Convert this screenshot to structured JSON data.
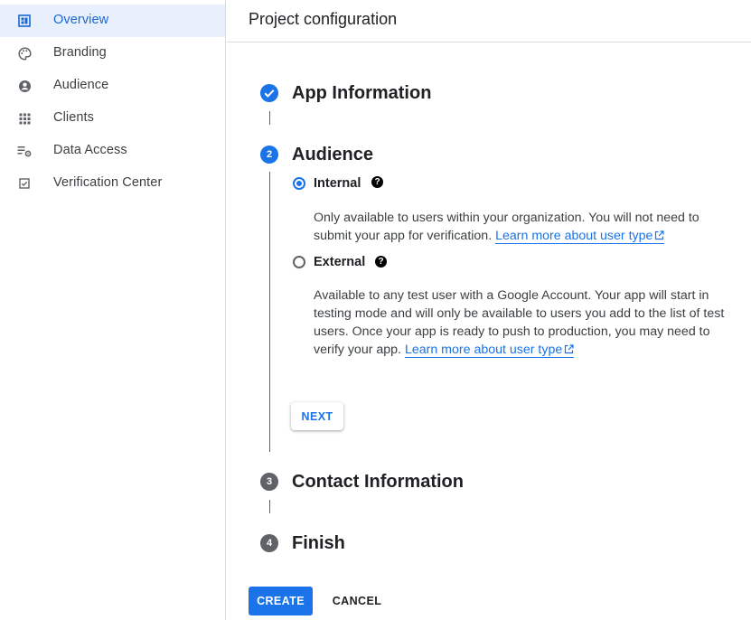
{
  "colors": {
    "accent": "#1a73e8",
    "active_bg": "#e8f0fe",
    "inactive_step": "#5f6368",
    "divider": "#dadce0"
  },
  "sidebar": {
    "items": [
      {
        "label": "Overview",
        "icon": "dashboard-icon",
        "active": true
      },
      {
        "label": "Branding",
        "icon": "palette-icon",
        "active": false
      },
      {
        "label": "Audience",
        "icon": "account-circle-icon",
        "active": false
      },
      {
        "label": "Clients",
        "icon": "apps-grid-icon",
        "active": false
      },
      {
        "label": "Data Access",
        "icon": "list-settings-icon",
        "active": false
      },
      {
        "label": "Verification Center",
        "icon": "check-box-icon",
        "active": false
      }
    ]
  },
  "header": {
    "title": "Project configuration"
  },
  "steps": [
    {
      "number": "",
      "title": "App Information",
      "status": "completed",
      "icon": "check-circle-icon"
    },
    {
      "number": "2",
      "title": "Audience",
      "status": "active"
    },
    {
      "number": "3",
      "title": "Contact Information",
      "status": "pending"
    },
    {
      "number": "4",
      "title": "Finish",
      "status": "pending"
    }
  ],
  "audience": {
    "options": [
      {
        "label": "Internal",
        "selected": true,
        "description": "Only available to users within your organization. You will not need to submit your app for verification.",
        "link": "Learn more about user type"
      },
      {
        "label": "External",
        "selected": false,
        "description": "Available to any test user with a Google Account. Your app will start in testing mode and will only be available to users you add to the list of test users. Once your app is ready to push to production, you may need to verify your app.",
        "link": "Learn more about user type"
      }
    ],
    "help_glyph": "?",
    "next_label": "NEXT"
  },
  "footer": {
    "create_label": "CREATE",
    "cancel_label": "CANCEL"
  }
}
